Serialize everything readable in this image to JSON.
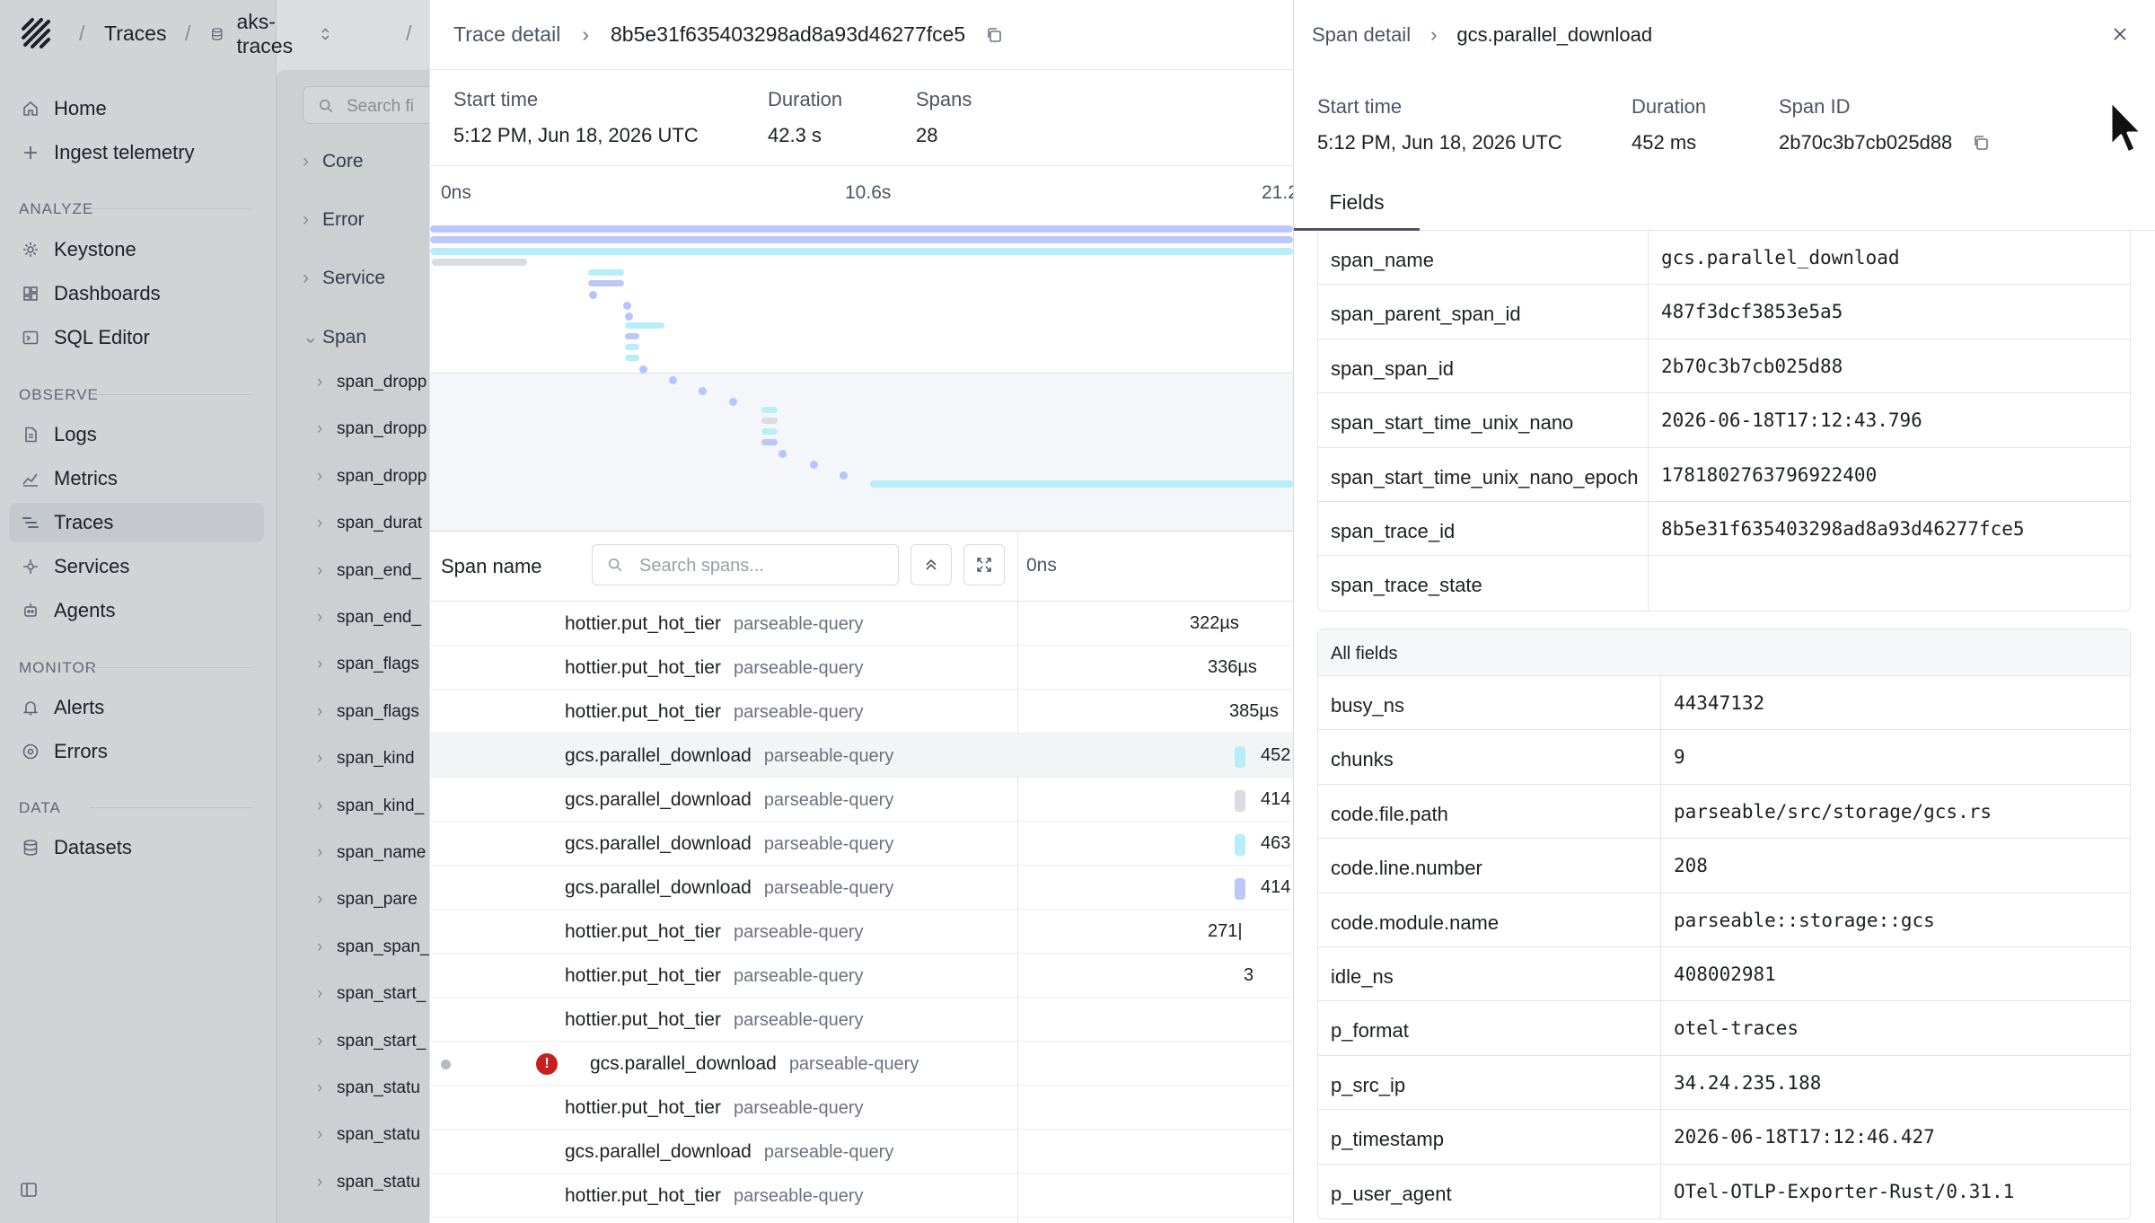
{
  "topbar": {
    "app": "Traces",
    "dataset": "aks-traces"
  },
  "nav": {
    "items_top": [
      {
        "label": "Home",
        "icon": "home-icon"
      },
      {
        "label": "Ingest telemetry",
        "icon": "plus-icon"
      }
    ],
    "sections": [
      {
        "title": "ANALYZE",
        "items": [
          {
            "label": "Keystone",
            "icon": "sparkle-icon"
          },
          {
            "label": "Dashboards",
            "icon": "dashboard-icon"
          },
          {
            "label": "SQL Editor",
            "icon": "terminal-icon"
          }
        ]
      },
      {
        "title": "OBSERVE",
        "items": [
          {
            "label": "Logs",
            "icon": "file-icon"
          },
          {
            "label": "Metrics",
            "icon": "chart-icon"
          },
          {
            "label": "Traces",
            "icon": "traces-icon",
            "active": true
          },
          {
            "label": "Services",
            "icon": "services-icon"
          },
          {
            "label": "Agents",
            "icon": "agent-icon"
          }
        ]
      },
      {
        "title": "MONITOR",
        "items": [
          {
            "label": "Alerts",
            "icon": "bell-icon"
          },
          {
            "label": "Errors",
            "icon": "error-icon"
          }
        ]
      },
      {
        "title": "DATA",
        "items": [
          {
            "label": "Datasets",
            "icon": "database-icon"
          }
        ]
      }
    ]
  },
  "filters": {
    "search_placeholder": "Search fi",
    "groups": [
      "Core",
      "Error",
      "Service",
      "Span"
    ],
    "fields": [
      "span_dropp",
      "span_dropp",
      "span_dropp",
      "span_durat",
      "span_end_",
      "span_end_",
      "span_flags",
      "span_flags",
      "span_kind",
      "span_kind_",
      "span_name",
      "span_pare",
      "span_span_",
      "span_start_",
      "span_start_",
      "span_statu",
      "span_statu",
      "span_statu"
    ]
  },
  "trace": {
    "crumb": "Trace detail",
    "id": "8b5e31f635403298ad8a93d46277fce5",
    "start_label": "Start time",
    "start": "5:12 PM, Jun 18, 2026 UTC",
    "duration_label": "Duration",
    "duration": "42.3 s",
    "spans_label": "Spans",
    "spans": "28",
    "ticks": [
      "0ns",
      "10.6s",
      "21.2"
    ],
    "span_name_label": "Span name",
    "search_placeholder": "Search spans...",
    "offset_label": "0ns",
    "rows": [
      {
        "name": "hottier.put_hot_tier",
        "service": "parseable-query",
        "dur": "322µs",
        "indent": 0
      },
      {
        "name": "hottier.put_hot_tier",
        "service": "parseable-query",
        "dur": "336µs",
        "indent": 0
      },
      {
        "name": "hottier.put_hot_tier",
        "service": "parseable-query",
        "dur": "385µs",
        "indent": 0
      },
      {
        "name": "gcs.parallel_download",
        "service": "parseable-query",
        "dur": "452",
        "indent": 0,
        "selected": true,
        "marker": "#b8eef7"
      },
      {
        "name": "gcs.parallel_download",
        "service": "parseable-query",
        "dur": "414",
        "indent": 0,
        "marker": "#d9dce1"
      },
      {
        "name": "gcs.parallel_download",
        "service": "parseable-query",
        "dur": "463",
        "indent": 0,
        "marker": "#b8eef7"
      },
      {
        "name": "gcs.parallel_download",
        "service": "parseable-query",
        "dur": "414",
        "indent": 0,
        "marker": "#bcc8fb"
      },
      {
        "name": "hottier.put_hot_tier",
        "service": "parseable-query",
        "dur": "271|",
        "indent": 0
      },
      {
        "name": "hottier.put_hot_tier",
        "service": "parseable-query",
        "dur": "3",
        "indent": 0
      },
      {
        "name": "hottier.put_hot_tier",
        "service": "parseable-query",
        "dur": "",
        "indent": 0
      },
      {
        "name": "gcs.parallel_download",
        "service": "parseable-query",
        "dur": "",
        "indent": 1,
        "error": true
      },
      {
        "name": "hottier.put_hot_tier",
        "service": "parseable-query",
        "dur": "",
        "indent": 0
      },
      {
        "name": "gcs.parallel_download",
        "service": "parseable-query",
        "dur": "",
        "indent": 0
      },
      {
        "name": "hottier.put_hot_tier",
        "service": "parseable-query",
        "dur": "",
        "indent": 0
      }
    ]
  },
  "span": {
    "crumb": "Span detail",
    "name": "gcs.parallel_download",
    "start_label": "Start time",
    "start": "5:12 PM, Jun 18, 2026 UTC",
    "duration_label": "Duration",
    "duration": "452 ms",
    "id_label": "Span ID",
    "id": "2b70c3b7cb025d88",
    "tab": "Fields",
    "fields": [
      {
        "k": "span_name",
        "v": "gcs.parallel_download"
      },
      {
        "k": "span_parent_span_id",
        "v": "487f3dcf3853e5a5"
      },
      {
        "k": "span_span_id",
        "v": "2b70c3b7cb025d88"
      },
      {
        "k": "span_start_time_unix_nano",
        "v": "2026-06-18T17:12:43.796"
      },
      {
        "k": "span_start_time_unix_nano_epoch",
        "v": "1781802763796922400"
      },
      {
        "k": "span_trace_id",
        "v": "8b5e31f635403298ad8a93d46277fce5"
      },
      {
        "k": "span_trace_state",
        "v": ""
      }
    ],
    "all_fields_label": "All fields",
    "all_fields": [
      {
        "k": "busy_ns",
        "v": "44347132"
      },
      {
        "k": "chunks",
        "v": "9"
      },
      {
        "k": "code.file.path",
        "v": "parseable/src/storage/gcs.rs"
      },
      {
        "k": "code.line.number",
        "v": "208"
      },
      {
        "k": "code.module.name",
        "v": "parseable::storage::gcs"
      },
      {
        "k": "idle_ns",
        "v": "408002981"
      },
      {
        "k": "p_format",
        "v": "otel-traces"
      },
      {
        "k": "p_src_ip",
        "v": "34.24.235.188"
      },
      {
        "k": "p_timestamp",
        "v": "2026-06-18T17:12:46.427"
      },
      {
        "k": "p_user_agent",
        "v": "OTel-OTLP-Exporter-Rust/0.31.1"
      }
    ]
  },
  "colors": {
    "bar_blue": "#bcc8fb",
    "bar_cyan": "#b8eef7",
    "bar_gray": "#d9dce1",
    "error": "#c81e1e"
  }
}
